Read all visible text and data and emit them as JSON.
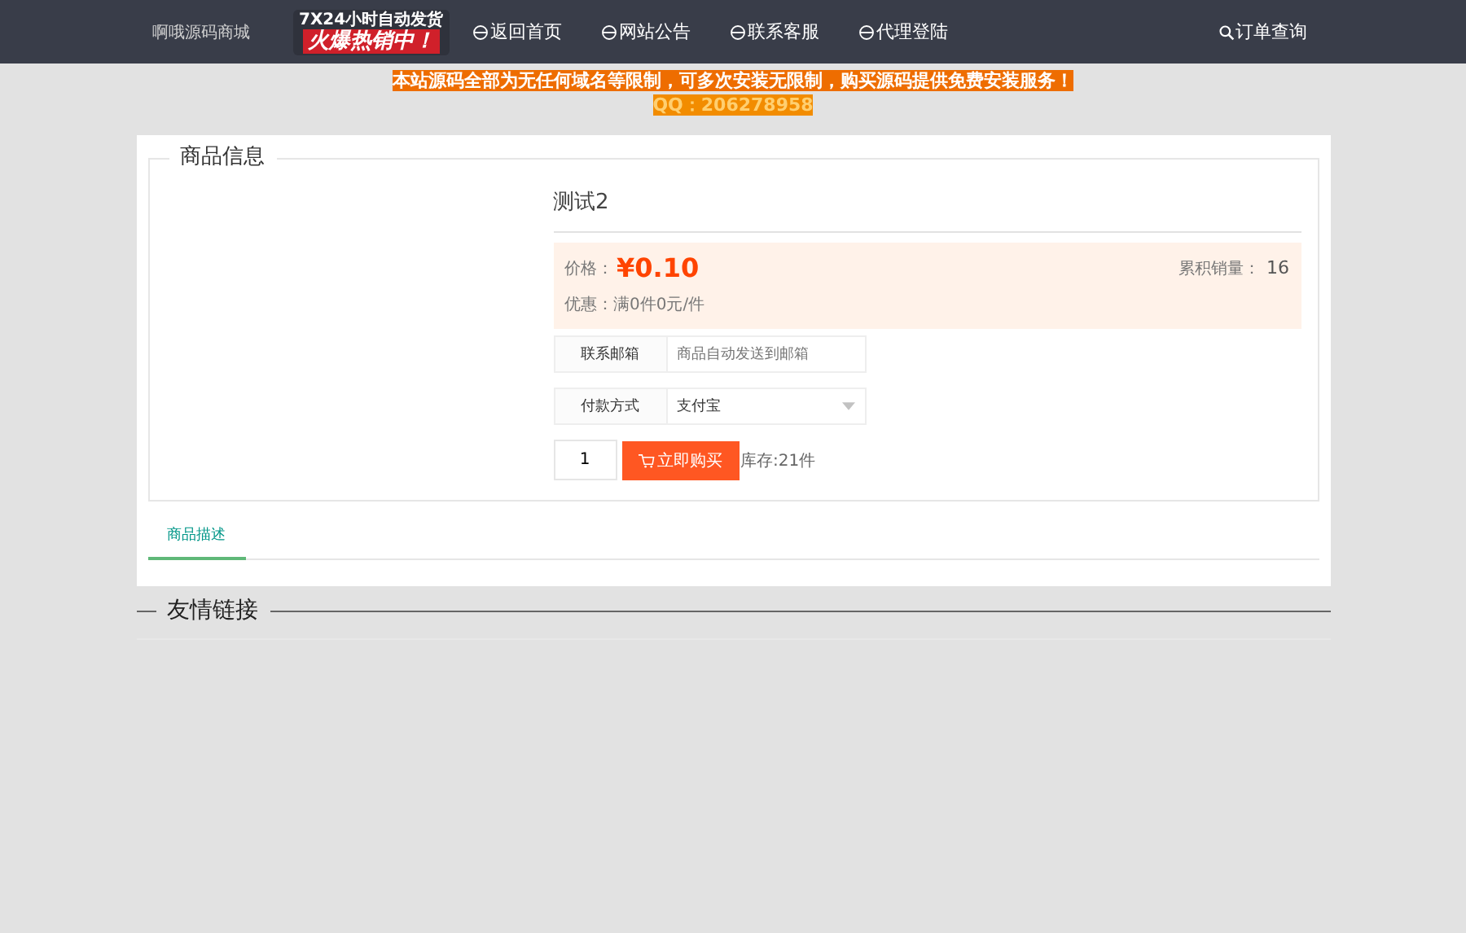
{
  "header": {
    "site_name": "啊哦源码商城",
    "promo": {
      "line_1": "7X24小时自动发货",
      "line_2": "火爆热销中！"
    },
    "nav": [
      {
        "label": "返回首页",
        "kind": "link"
      },
      {
        "label": "网站公告",
        "kind": "link"
      },
      {
        "label": "联系客服",
        "kind": "link"
      },
      {
        "label": "代理登陆",
        "kind": "link"
      }
    ],
    "order_query": "订单查询"
  },
  "notice": {
    "line_1": "本站源码全部为无任何域名等限制，可多次安装无限制，购买源码提供免费安装服务！",
    "line_2": "QQ：206278958"
  },
  "product": {
    "legend": "商品信息",
    "title": "测试2",
    "price_label": "价格：",
    "price": "¥0.10",
    "sales_label": "累积销量：",
    "sales": "16",
    "discount": "优惠：满0件0元/件",
    "email": {
      "label": "联系邮箱",
      "placeholder": "商品自动发送到邮箱"
    },
    "payment": {
      "label": "付款方式",
      "value": "支付宝"
    },
    "quantity": "1",
    "buy_button": "立即购买",
    "stock": "库存:21件"
  },
  "tabs": [
    {
      "label": "商品描述",
      "selected": true
    }
  ],
  "links_heading": "友情链接"
}
